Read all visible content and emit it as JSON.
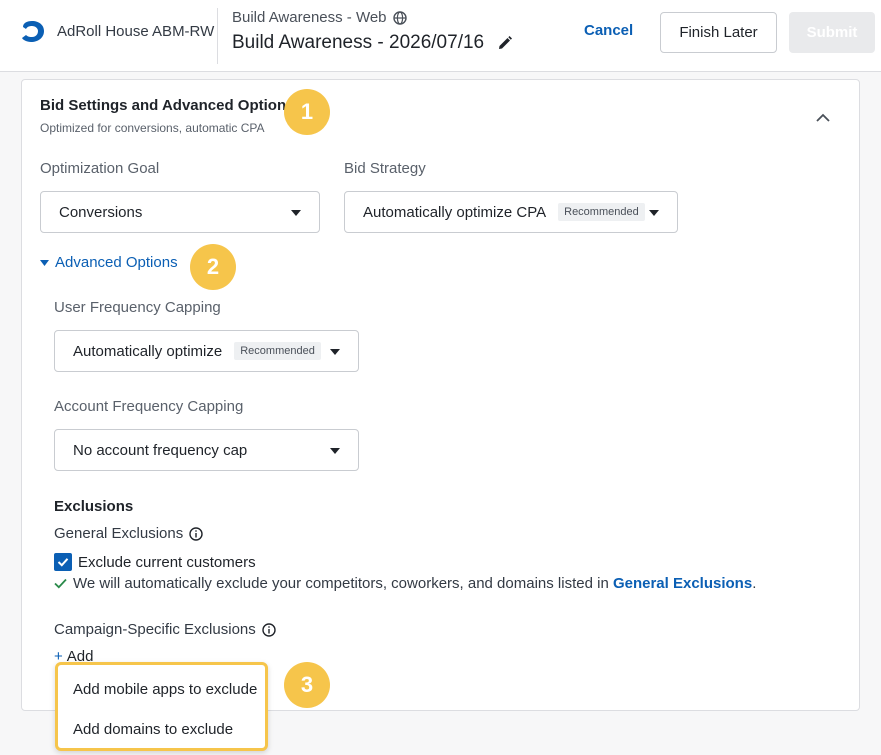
{
  "header": {
    "account_name": "AdRoll House ABM-RW",
    "campaign_type": "Build Awareness - Web",
    "campaign_title": "Build Awareness - 2026/07/16",
    "cancel_label": "Cancel",
    "finish_later_label": "Finish Later",
    "submit_label": "Submit"
  },
  "card": {
    "title": "Bid Settings and Advanced Options",
    "subtitle": "Optimized for conversions, automatic CPA",
    "optimization_goal": {
      "label": "Optimization Goal",
      "value": "Conversions"
    },
    "bid_strategy": {
      "label": "Bid Strategy",
      "value": "Automatically optimize CPA",
      "badge": "Recommended"
    },
    "advanced_toggle_label": "Advanced Options",
    "user_frequency": {
      "label": "User Frequency Capping",
      "value": "Automatically optimize",
      "badge": "Recommended"
    },
    "account_frequency": {
      "label": "Account Frequency Capping",
      "value": "No account frequency cap"
    },
    "exclusions": {
      "heading": "Exclusions",
      "general_label": "General Exclusions",
      "checkbox_label": "Exclude current customers",
      "note_text": "We will automatically exclude your competitors, coworkers, and domains listed in ",
      "note_link": "General Exclusions",
      "note_end": ".",
      "campaign_specific_label": "Campaign-Specific Exclusions",
      "add_plus": "+",
      "add_label": "Add"
    }
  },
  "dropdown": {
    "items": [
      "Add mobile apps to exclude",
      "Add domains to exclude"
    ]
  },
  "callouts": [
    "1",
    "2",
    "3"
  ],
  "colors": {
    "accent": "#0b5fb4",
    "callout": "#f6c54b",
    "submit_disabled": "#e9eaec"
  }
}
